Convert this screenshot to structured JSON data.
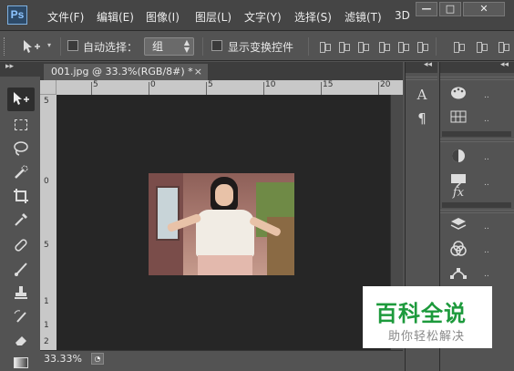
{
  "app": {
    "logo": "Ps"
  },
  "menu": {
    "items": [
      "文件(F)",
      "编辑(E)",
      "图像(I)",
      "图层(L)",
      "文字(Y)",
      "选择(S)",
      "滤镜(T)",
      "3D"
    ]
  },
  "window_controls": {
    "minimize": "—",
    "restore": "□",
    "close": "✕"
  },
  "options": {
    "auto_select_label": "自动选择：",
    "auto_select_checked": false,
    "auto_select_value": "组",
    "show_transform_label": "显示变换控件",
    "show_transform_checked": false
  },
  "document": {
    "tab_title": "001.jpg @ 33.3%(RGB/8#) *",
    "tab_close": "×"
  },
  "ruler": {
    "top_ticks": [
      "5",
      "0",
      "5",
      "10",
      "15",
      "20"
    ],
    "left_ticks": [
      "5",
      "0",
      "5",
      "1",
      "1",
      "2"
    ]
  },
  "status": {
    "zoom": "33.33%"
  },
  "panels": {
    "strip1_icons": [
      "character-icon",
      "paragraph-icon"
    ],
    "strip2_icons": [
      "palette-icon",
      "swatches-icon",
      "adjustments-icon",
      "styles-icon",
      "layers-icon",
      "channels-icon",
      "paths-icon"
    ],
    "dots": "..",
    "collapse": "◂◂",
    "expand": "▸▸"
  },
  "watermark": {
    "title": "百科全说",
    "subtitle": "助你轻松解决"
  },
  "colors": {
    "menubar_bg": "#454545",
    "workspace_bg": "#535353",
    "canvas_bg": "#262626",
    "watermark_green": "#1d9a3c"
  }
}
